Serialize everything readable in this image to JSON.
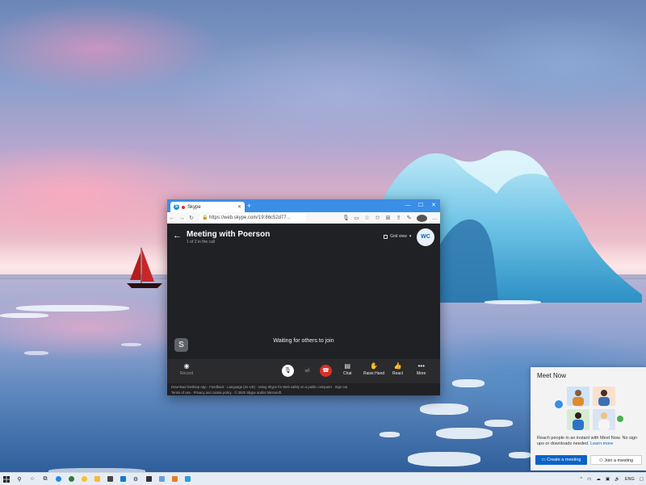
{
  "browser": {
    "tab_title": "Skype",
    "url": "https://web.skype.com/19:86c52d77..."
  },
  "meeting": {
    "title": "Meeting with Poerson",
    "subtitle": "1 of 2 in the call",
    "grid_view_label": "Grid view",
    "avatar_initials": "WC",
    "waiting_text": "Waiting for others to join",
    "controls": {
      "record": "Record",
      "chat": "Chat",
      "raise_hand": "Raise Hand",
      "react": "React",
      "more": "More"
    },
    "footer": {
      "download": "Download Desktop App",
      "feedback": "Feedback",
      "language": "Language (en-US)",
      "safety": "Using Skype for Web safely on a public computer",
      "signout": "Sign out",
      "terms": "Terms of use",
      "privacy": "Privacy and cookie policy",
      "copyright": "© 2020 Skype and/or Microsoft."
    }
  },
  "meet_now": {
    "title": "Meet Now",
    "description": "Reach people in an instant with Meet Now. No sign ups or downloads needed.",
    "learn_more": "Learn more",
    "create_button": "Create a meeting",
    "join_button": "Join a meeting"
  },
  "taskbar": {
    "language": "ENG"
  },
  "icons": [
    "windows-start-icon",
    "search-icon",
    "task-view-icon",
    "edge-icon",
    "mic-icon",
    "video-icon",
    "end-call-icon",
    "chat-icon",
    "hand-icon",
    "react-icon",
    "more-icon"
  ],
  "colors": {
    "accent": "#0a64c8",
    "end_call": "#d93025",
    "tab_bar": "#3a8ee6",
    "app_bg": "#202124"
  }
}
